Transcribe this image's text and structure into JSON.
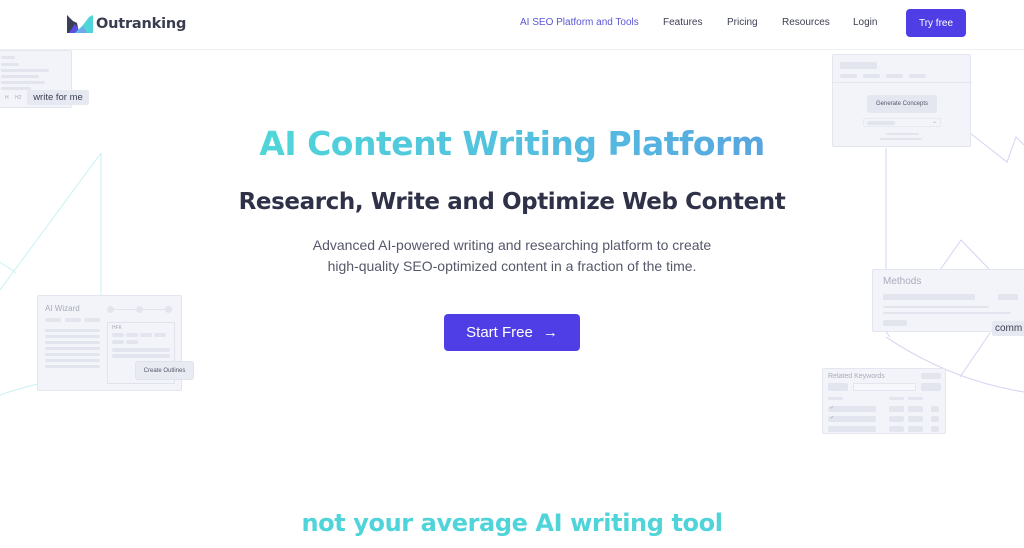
{
  "brand": {
    "name": "Outranking",
    "colors": {
      "primary": "#4f3ee6",
      "accent_teal": "#4fd4da",
      "accent_blue": "#5a9ee0",
      "nav_active": "#5a56d6",
      "text_dark": "#2e3148"
    }
  },
  "nav": {
    "items": [
      {
        "label": "AI SEO Platform and Tools",
        "active": true
      },
      {
        "label": "Features",
        "active": false
      },
      {
        "label": "Pricing",
        "active": false
      },
      {
        "label": "Resources",
        "active": false
      },
      {
        "label": "Login",
        "active": false
      }
    ],
    "cta_label": "Try free"
  },
  "hero": {
    "title": "AI Content Writing Platform",
    "subtitle": "Research, Write and Optimize Web Content",
    "description_line1": "Advanced AI-powered writing and researching platform to create",
    "description_line2": "high-quality SEO-optimized content in a fraction of the time.",
    "cta_label": "Start Free",
    "cta_icon": "arrow-right-icon",
    "cta_arrow": "→"
  },
  "decorations": {
    "write_chip": "write for me",
    "editor_toolbar": [
      "H",
      "H2"
    ],
    "concepts_button": "Generate Concepts",
    "wizard_title": "AI Wizard",
    "wizard_box_label": "HFK",
    "wizard_button": "Create Outlines",
    "methods_title": "Methods",
    "comm_chip": "comm",
    "keywords_title": "Related Keywords",
    "checkmark": "✓"
  },
  "section": {
    "tagline": "not your average AI writing tool"
  }
}
